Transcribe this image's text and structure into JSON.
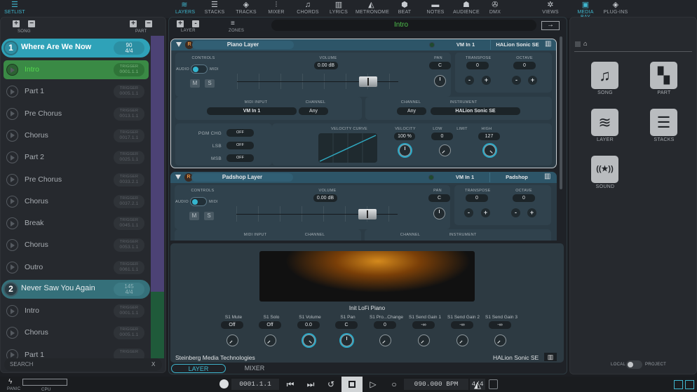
{
  "toolbar": {
    "left": {
      "label": "SETLIST",
      "icon": "list-icon"
    },
    "items": [
      {
        "label": "LAYERS",
        "icon": "layers-icon",
        "active": true
      },
      {
        "label": "STACKS",
        "icon": "stacks-icon"
      },
      {
        "label": "TRACKS",
        "icon": "cube-icon"
      },
      {
        "label": "MIXER",
        "icon": "mixer-icon"
      },
      {
        "label": "CHORDS",
        "icon": "music-note-icon"
      },
      {
        "label": "LYRICS",
        "icon": "book-icon"
      },
      {
        "label": "METRONOME",
        "icon": "metronome-icon"
      },
      {
        "label": "BEAT",
        "icon": "beat-icon"
      },
      {
        "label": "NOTES",
        "icon": "notes-icon"
      },
      {
        "label": "AUDIENCE",
        "icon": "audience-icon"
      },
      {
        "label": "DMX",
        "icon": "dmx-icon"
      },
      {
        "label": "VIEWS",
        "icon": "gear-icon"
      }
    ],
    "right": [
      {
        "label": "MEDIA BAY",
        "icon": "media-bay-icon",
        "active": true
      },
      {
        "label": "PLUG-INS",
        "icon": "plugins-icon"
      }
    ]
  },
  "setlist": {
    "song_label": "SONG",
    "part_label": "PART",
    "add": "+",
    "remove": "−",
    "songs": [
      {
        "number": "1",
        "name": "Where Are We Now",
        "tempo": "90",
        "signature": "4/4",
        "parts": [
          {
            "name": "Intro",
            "trigger": "TRIGGER",
            "position": "0001.1.1",
            "active": true
          },
          {
            "name": "Part 1",
            "trigger": "TRIGGER",
            "position": "0005.1.1"
          },
          {
            "name": "Pre Chorus",
            "trigger": "TRIGGER",
            "position": "0013.1.1"
          },
          {
            "name": "Chorus",
            "trigger": "TRIGGER",
            "position": "0017.1.1"
          },
          {
            "name": "Part 2",
            "trigger": "TRIGGER",
            "position": "0025.1.1"
          },
          {
            "name": "Pre Chorus",
            "trigger": "TRIGGER",
            "position": "0033.2.1"
          },
          {
            "name": "Chorus",
            "trigger": "TRIGGER",
            "position": "0037.2.1"
          },
          {
            "name": "Break",
            "trigger": "TRIGGER",
            "position": "0045.1.1"
          },
          {
            "name": "Chorus",
            "trigger": "TRIGGER",
            "position": "0053.1.1"
          },
          {
            "name": "Outro",
            "trigger": "TRIGGER",
            "position": "0061.1.1"
          }
        ]
      },
      {
        "number": "2",
        "name": "Never Saw You Again",
        "tempo": "145",
        "signature": "4/4",
        "parts": [
          {
            "name": "Intro",
            "trigger": "TRIGGER",
            "position": "0001.1.1"
          },
          {
            "name": "Chorus",
            "trigger": "TRIGGER",
            "position": "0005.1.1"
          },
          {
            "name": "Part 1",
            "trigger": "TRIGGER",
            "position": ""
          }
        ]
      }
    ],
    "search_placeholder": "SEARCH",
    "search_clear": "X"
  },
  "layers_view": {
    "layer_label": "LAYER",
    "zones_label": "ZONES",
    "current_part": "Intro",
    "arrow": "→",
    "layers": [
      {
        "name": "Piano Layer",
        "r": "R",
        "midi_in": "VM In 1",
        "instrument": "HALion Sonic SE",
        "controls_label": "CONTROLS",
        "audio": "AUDIO",
        "midi": "MIDI",
        "m": "M",
        "s": "S",
        "volume_label": "VOLUME",
        "volume": "0.00 dB",
        "pan_label": "PAN",
        "pan": "C",
        "transpose_label": "TRANSPOSE",
        "transpose": "0",
        "octave_label": "OCTAVE",
        "octave": "0",
        "midi_input_label": "MIDI INPUT",
        "channel_label": "CHANNEL",
        "in_channel": "Any",
        "out_channel": "Any",
        "instrument_label": "INSTRUMENT",
        "pgm_chg_label": "PGM CHG",
        "pgm_chg": "OFF",
        "lsb_label": "LSB",
        "lsb": "OFF",
        "msb_label": "MSB",
        "msb": "OFF",
        "velocity_curve_label": "VELOCITY CURVE",
        "velocity_label": "VELOCITY",
        "velocity": "100 %",
        "low_label": "LOW",
        "low": "0",
        "limit_label": "LIMIT",
        "high_label": "HIGH",
        "high": "127"
      },
      {
        "name": "Padshop Layer",
        "r": "R",
        "midi_in": "VM In 1",
        "instrument": "Padshop",
        "controls_label": "CONTROLS",
        "audio": "AUDIO",
        "midi": "MIDI",
        "m": "M",
        "s": "S",
        "volume_label": "VOLUME",
        "volume": "0.00 dB",
        "pan_label": "PAN",
        "pan": "C",
        "transpose_label": "TRANSPOSE",
        "transpose": "0",
        "octave_label": "OCTAVE",
        "octave": "0",
        "midi_input_label": "MIDI INPUT",
        "channel_label": "CHANNEL",
        "instrument_label": "INSTRUMENT"
      }
    ],
    "plus": "+",
    "minus": "-"
  },
  "instrument_panel": {
    "preset": "Init LoFi Piano",
    "params": [
      {
        "label": "S1 Mute",
        "value": "Off"
      },
      {
        "label": "S1 Solo",
        "value": "Off"
      },
      {
        "label": "S1 Volume",
        "value": "0.0"
      },
      {
        "label": "S1 Pan",
        "value": "C"
      },
      {
        "label": "S1 Pro...Change",
        "value": "0"
      },
      {
        "label": "S1 Send Gain 1",
        "value": "-∞"
      },
      {
        "label": "S1 Send Gain 2",
        "value": "-∞"
      },
      {
        "label": "S1 Send Gain 3",
        "value": "-∞"
      }
    ],
    "vendor": "Steinberg Media Technologies",
    "plugin": "HALion Sonic SE",
    "tabs": [
      {
        "label": "LAYER",
        "active": true
      },
      {
        "label": "MIXER"
      }
    ]
  },
  "media_bay": {
    "tiles": [
      {
        "label": "SONG",
        "icon": "music-note-icon",
        "glyph": "♫"
      },
      {
        "label": "PART",
        "icon": "part-icon",
        "glyph": "▚"
      },
      {
        "label": "LAYER",
        "icon": "layers-icon",
        "glyph": "≋"
      },
      {
        "label": "STACKS",
        "icon": "stacks-icon",
        "glyph": "☰"
      },
      {
        "label": "SOUND",
        "icon": "sound-icon",
        "glyph": "((★))"
      }
    ],
    "local_label": "LOCAL",
    "project_label": "PROJECT"
  },
  "transport": {
    "panic_label": "PANIC",
    "cpu_label": "CPU",
    "position": "0001.1.1",
    "tempo": "090.000 BPM",
    "signature": "4/4"
  }
}
